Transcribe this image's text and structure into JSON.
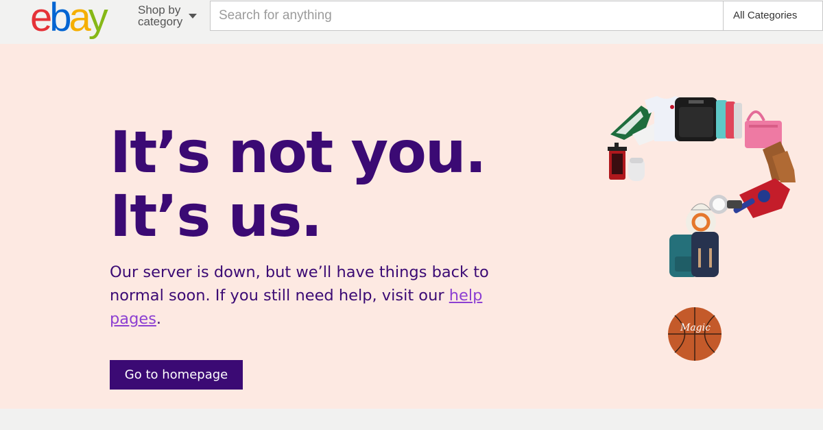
{
  "header": {
    "logo_letters": [
      "e",
      "b",
      "a",
      "y"
    ],
    "shop_by_category_line1": "Shop by",
    "shop_by_category_line2": "category",
    "search_placeholder": "Search for anything",
    "category_select_value": "All Categories"
  },
  "hero": {
    "headline_line1": "It’s not you.",
    "headline_line2": "It’s us.",
    "message_text": "Our server is down, but we’ll have things back to normal soon. If you still need help, visit our ",
    "help_link_text": "help pages",
    "message_end": ".",
    "button_label": "Go to homepage",
    "illustration_ball_signature": "Magic"
  },
  "colors": {
    "hero_bg": "#fde9e2",
    "brand_purple": "#3b0a74",
    "link_purple": "#8c3fd2",
    "logo_red": "#e53238",
    "logo_blue": "#0064d2",
    "logo_yellow": "#f5af02",
    "logo_green": "#86b817"
  },
  "icons": {
    "dropdown": "caret-down-icon",
    "illustration": "question-mark-product-collage"
  }
}
